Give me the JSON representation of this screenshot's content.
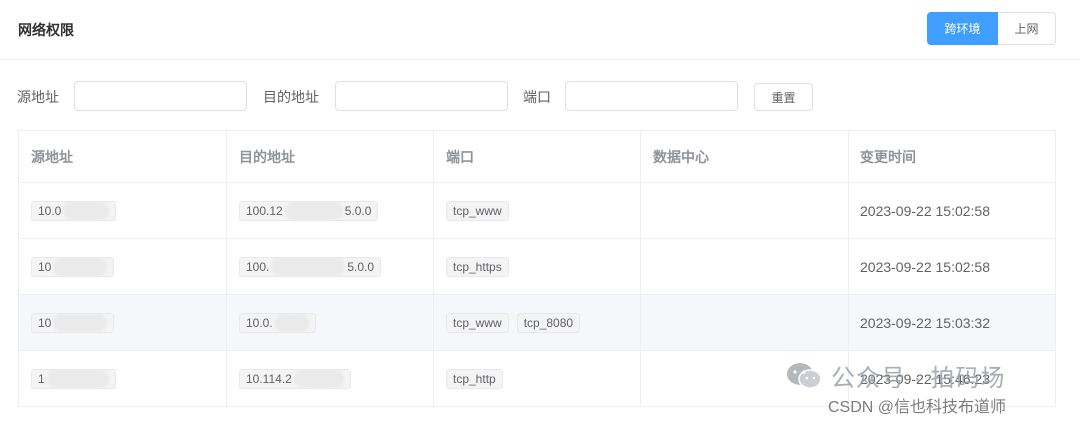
{
  "header": {
    "title": "网络权限",
    "segments": [
      {
        "label": "跨环境",
        "active": true
      },
      {
        "label": "上网",
        "active": false
      }
    ]
  },
  "filters": {
    "source_label": "源地址",
    "dest_label": "目的地址",
    "port_label": "端口",
    "reset_label": "重置",
    "source_value": "",
    "dest_value": "",
    "port_value": ""
  },
  "table": {
    "columns": [
      "源地址",
      "目的地址",
      "端口",
      "数据中心",
      "变更时间"
    ],
    "rows": [
      {
        "source": "10.0",
        "dest_a": "100.12",
        "dest_b": "5.0.0",
        "ports": [
          "tcp_www"
        ],
        "datacenter": "",
        "time": "2023-09-22 15:02:58"
      },
      {
        "source": "10",
        "dest_a": "100.",
        "dest_b": "5.0.0",
        "ports": [
          "tcp_https"
        ],
        "datacenter": "",
        "time": "2023-09-22 15:02:58"
      },
      {
        "source": "10",
        "dest_a": "10.0.",
        "dest_b": "",
        "ports": [
          "tcp_www",
          "tcp_8080"
        ],
        "datacenter": "",
        "time": "2023-09-22 15:03:32"
      },
      {
        "source": "1",
        "dest_a": "10.114.2",
        "dest_b": "",
        "ports": [
          "tcp_http"
        ],
        "datacenter": "",
        "time": "2023-09-22 15:46:23"
      }
    ]
  },
  "watermark": {
    "text": "公众号 · 拍码场",
    "csdn": "CSDN @信也科技布道师"
  },
  "colors": {
    "accent": "#409eff"
  }
}
